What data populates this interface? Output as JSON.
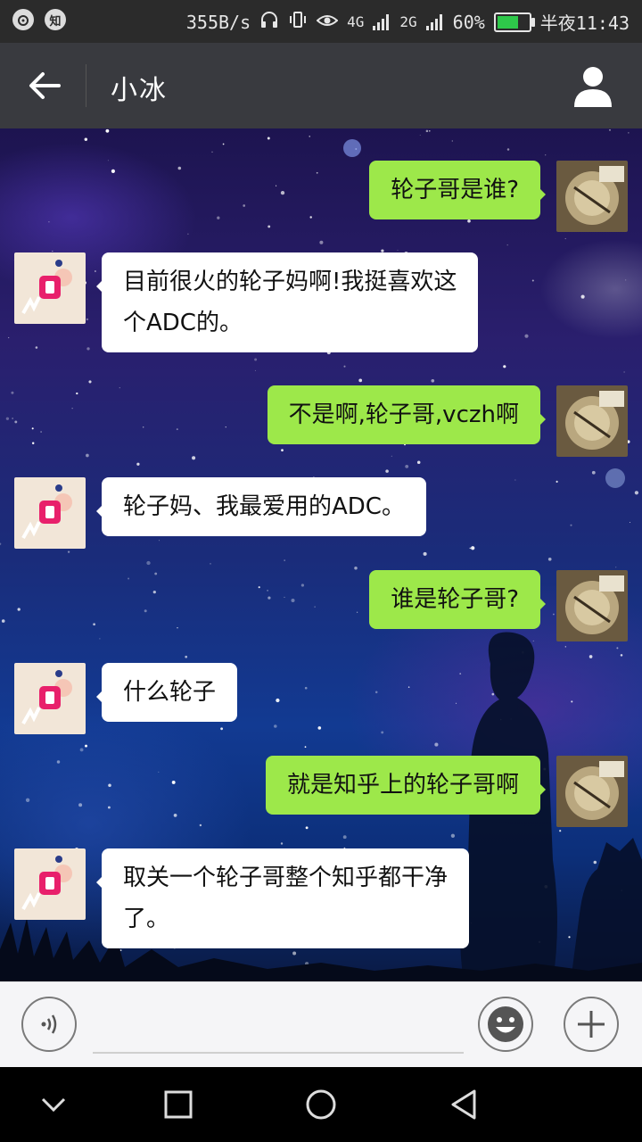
{
  "status_bar": {
    "left_icons": [
      "weibo-icon",
      "zhihu-icon"
    ],
    "zhihu_label": "知",
    "net_speed": "355B/s",
    "signal_label_1": "4G",
    "signal_label_2": "2G",
    "battery": "60%",
    "time": "半夜11:43"
  },
  "header": {
    "title": "小冰"
  },
  "messages": [
    {
      "side": "me",
      "lines": [
        "轮子哥是谁?"
      ]
    },
    {
      "side": "bot",
      "lines": [
        "目前很火的轮子妈啊!我挺喜欢这",
        "个ADC的。"
      ]
    },
    {
      "side": "me",
      "lines": [
        "不是啊,轮子哥,vczh啊"
      ]
    },
    {
      "side": "bot",
      "lines": [
        "轮子妈、我最爱用的ADC。"
      ]
    },
    {
      "side": "me",
      "lines": [
        "谁是轮子哥?"
      ]
    },
    {
      "side": "bot",
      "lines": [
        "什么轮子"
      ]
    },
    {
      "side": "me",
      "lines": [
        "就是知乎上的轮子哥啊"
      ]
    },
    {
      "side": "bot",
      "lines": [
        "取关一个轮子哥整个知乎都干净",
        "了。"
      ]
    }
  ],
  "input": {
    "value": ""
  },
  "colors": {
    "me_bubble": "#9de84a",
    "bot_bubble": "#ffffff",
    "title_bar": "#393a3f",
    "status_bar": "#2b2b2b"
  }
}
